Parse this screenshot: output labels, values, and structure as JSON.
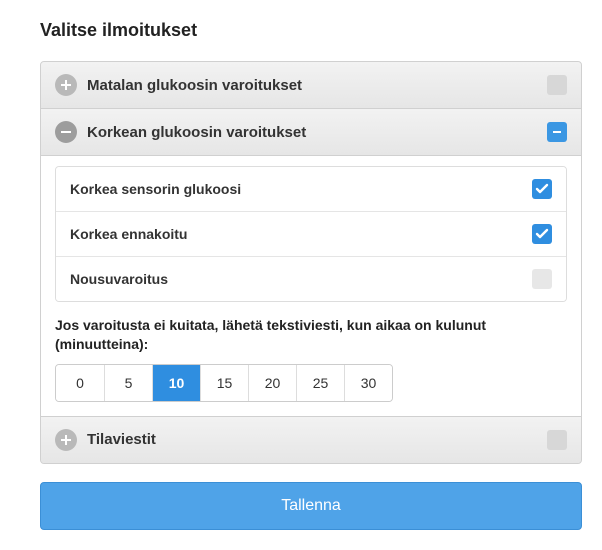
{
  "title": "Valitse ilmoitukset",
  "sections": {
    "low": {
      "label": "Matalan glukoosin varoitukset",
      "expanded": false,
      "state": "disabled"
    },
    "high": {
      "label": "Korkean glukoosin varoitukset",
      "expanded": true,
      "state": "active",
      "options": [
        {
          "label": "Korkea sensorin glukoosi",
          "checked": true
        },
        {
          "label": "Korkea ennakoitu",
          "checked": true
        },
        {
          "label": "Nousuvaroitus",
          "checked": false
        }
      ],
      "delay_text": "Jos varoitusta ei kuitata, lähetä tekstiviesti, kun aikaa on kulunut (minuutteina):",
      "delay_values": [
        "0",
        "5",
        "10",
        "15",
        "20",
        "25",
        "30"
      ],
      "delay_selected": "10"
    },
    "status": {
      "label": "Tilaviestit",
      "expanded": false,
      "state": "disabled"
    }
  },
  "save_label": "Tallenna"
}
